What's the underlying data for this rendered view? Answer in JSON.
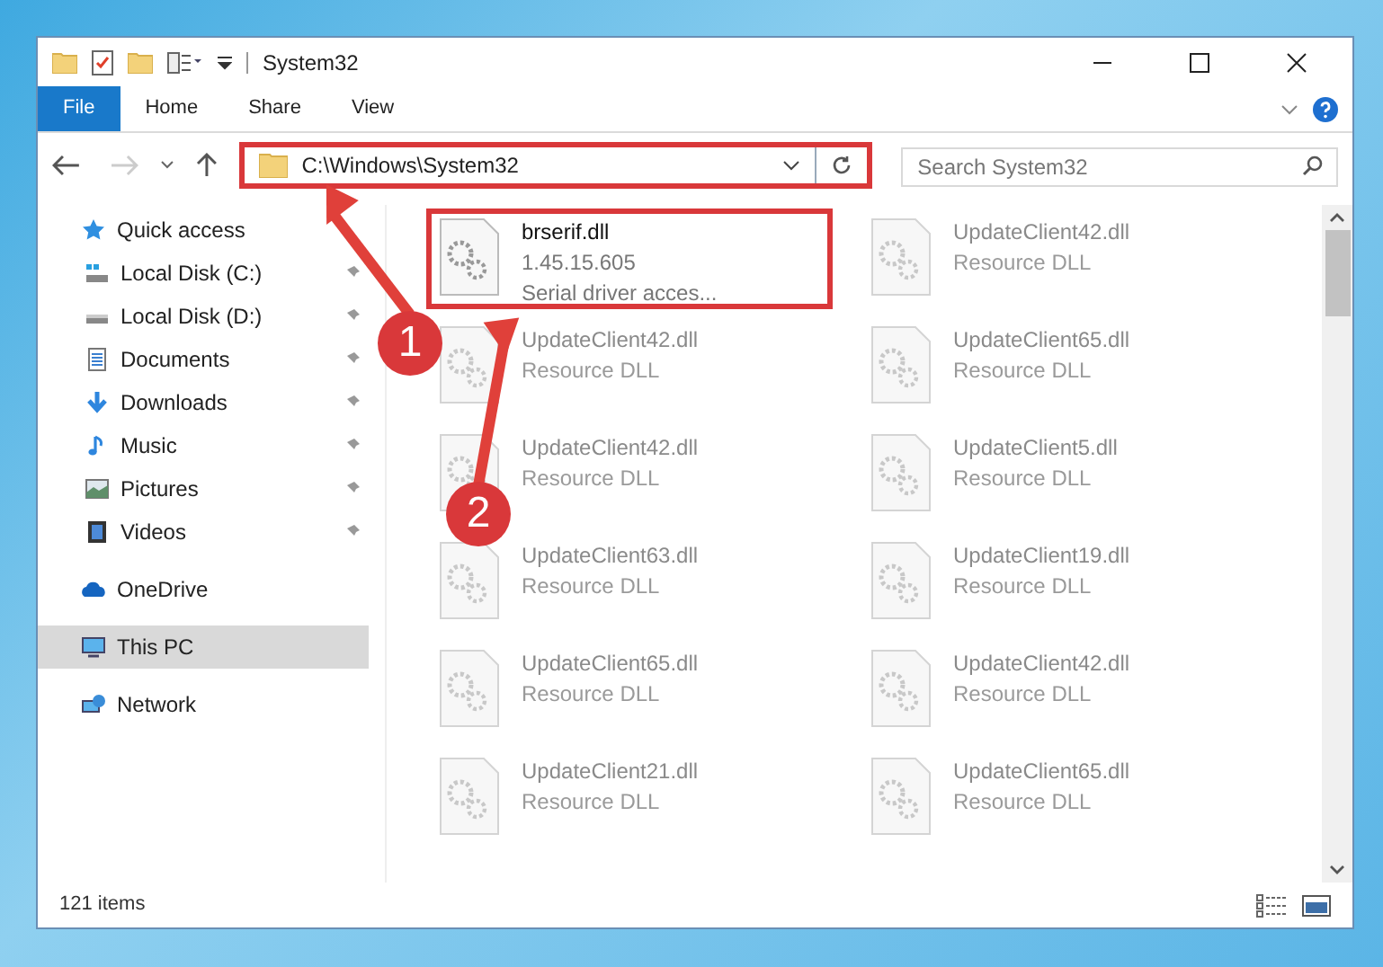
{
  "window": {
    "title": "System32"
  },
  "ribbon": {
    "tabs": [
      {
        "label": "File",
        "selected": true
      },
      {
        "label": "Home",
        "selected": false
      },
      {
        "label": "Share",
        "selected": false
      },
      {
        "label": "View",
        "selected": false
      }
    ]
  },
  "address_bar": {
    "path": "C:\\Windows\\System32",
    "highlighted": true
  },
  "search": {
    "placeholder": "Search System32"
  },
  "sidebar": {
    "items": [
      {
        "label": "Quick access",
        "kind": "star",
        "selected": false,
        "children": [
          {
            "label": "Local Disk (C:)",
            "kind": "drive-win",
            "pinned": true,
            "selected": false
          },
          {
            "label": "Local Disk (D:)",
            "kind": "drive",
            "pinned": true,
            "selected": false
          },
          {
            "label": "Documents",
            "kind": "document",
            "pinned": true,
            "selected": false
          },
          {
            "label": "Downloads",
            "kind": "download",
            "pinned": true,
            "selected": false
          },
          {
            "label": "Music",
            "kind": "music",
            "pinned": true,
            "selected": false
          },
          {
            "label": "Pictures",
            "kind": "picture",
            "pinned": true,
            "selected": false
          },
          {
            "label": "Videos",
            "kind": "video",
            "pinned": true,
            "selected": false
          }
        ]
      },
      {
        "label": "OneDrive",
        "kind": "cloud",
        "selected": false
      },
      {
        "label": "This PC",
        "kind": "monitor",
        "selected": true
      },
      {
        "label": "Network",
        "kind": "network",
        "selected": false
      }
    ]
  },
  "files": [
    {
      "name": "brserif.dll",
      "details": [
        "1.45.15.605",
        "Serial driver acces..."
      ],
      "blurred": false,
      "highlighted": true
    },
    {
      "name": "UpdateClient42.dll",
      "details": [
        "Resource DLL"
      ],
      "blurred": true,
      "highlighted": false
    },
    {
      "name": "UpdateClient42.dll",
      "details": [
        "Resource DLL"
      ],
      "blurred": true,
      "highlighted": false
    },
    {
      "name": "UpdateClient65.dll",
      "details": [
        "Resource DLL"
      ],
      "blurred": true,
      "highlighted": false
    },
    {
      "name": "UpdateClient42.dll",
      "details": [
        "Resource DLL"
      ],
      "blurred": true,
      "highlighted": false
    },
    {
      "name": "UpdateClient5.dll",
      "details": [
        "Resource DLL"
      ],
      "blurred": true,
      "highlighted": false
    },
    {
      "name": "UpdateClient63.dll",
      "details": [
        "Resource DLL"
      ],
      "blurred": true,
      "highlighted": false
    },
    {
      "name": "UpdateClient19.dll",
      "details": [
        "Resource DLL"
      ],
      "blurred": true,
      "highlighted": false
    },
    {
      "name": "UpdateClient65.dll",
      "details": [
        "Resource DLL"
      ],
      "blurred": true,
      "highlighted": false
    },
    {
      "name": "UpdateClient42.dll",
      "details": [
        "Resource DLL"
      ],
      "blurred": true,
      "highlighted": false
    },
    {
      "name": "UpdateClient21.dll",
      "details": [
        "Resource DLL"
      ],
      "blurred": true,
      "highlighted": false
    },
    {
      "name": "UpdateClient65.dll",
      "details": [
        "Resource DLL"
      ],
      "blurred": true,
      "highlighted": false
    }
  ],
  "status_bar": {
    "item_count": "121 items"
  },
  "annotations": [
    {
      "label": "1"
    },
    {
      "label": "2"
    }
  ]
}
